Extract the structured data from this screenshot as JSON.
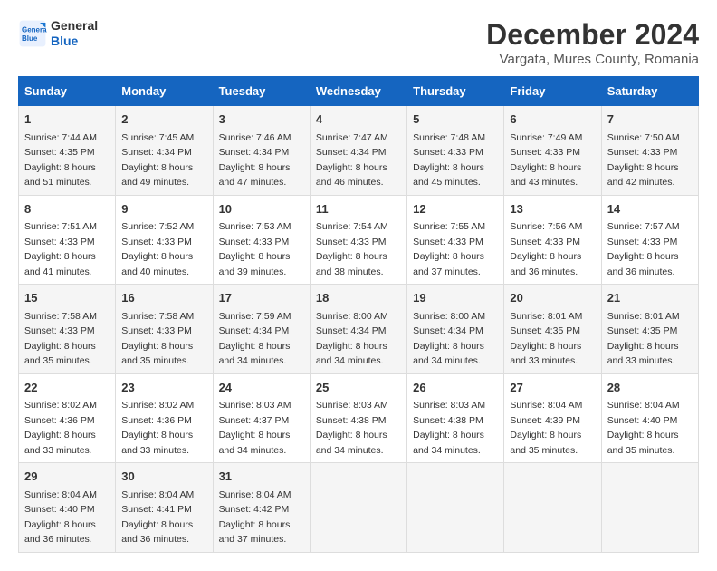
{
  "logo": {
    "line1": "General",
    "line2": "Blue"
  },
  "title": "December 2024",
  "subtitle": "Vargata, Mures County, Romania",
  "days_of_week": [
    "Sunday",
    "Monday",
    "Tuesday",
    "Wednesday",
    "Thursday",
    "Friday",
    "Saturday"
  ],
  "weeks": [
    [
      {
        "day": 1,
        "rise": "7:44 AM",
        "set": "4:35 PM",
        "daylight": "8 hours and 51 minutes."
      },
      {
        "day": 2,
        "rise": "7:45 AM",
        "set": "4:34 PM",
        "daylight": "8 hours and 49 minutes."
      },
      {
        "day": 3,
        "rise": "7:46 AM",
        "set": "4:34 PM",
        "daylight": "8 hours and 47 minutes."
      },
      {
        "day": 4,
        "rise": "7:47 AM",
        "set": "4:34 PM",
        "daylight": "8 hours and 46 minutes."
      },
      {
        "day": 5,
        "rise": "7:48 AM",
        "set": "4:33 PM",
        "daylight": "8 hours and 45 minutes."
      },
      {
        "day": 6,
        "rise": "7:49 AM",
        "set": "4:33 PM",
        "daylight": "8 hours and 43 minutes."
      },
      {
        "day": 7,
        "rise": "7:50 AM",
        "set": "4:33 PM",
        "daylight": "8 hours and 42 minutes."
      }
    ],
    [
      {
        "day": 8,
        "rise": "7:51 AM",
        "set": "4:33 PM",
        "daylight": "8 hours and 41 minutes."
      },
      {
        "day": 9,
        "rise": "7:52 AM",
        "set": "4:33 PM",
        "daylight": "8 hours and 40 minutes."
      },
      {
        "day": 10,
        "rise": "7:53 AM",
        "set": "4:33 PM",
        "daylight": "8 hours and 39 minutes."
      },
      {
        "day": 11,
        "rise": "7:54 AM",
        "set": "4:33 PM",
        "daylight": "8 hours and 38 minutes."
      },
      {
        "day": 12,
        "rise": "7:55 AM",
        "set": "4:33 PM",
        "daylight": "8 hours and 37 minutes."
      },
      {
        "day": 13,
        "rise": "7:56 AM",
        "set": "4:33 PM",
        "daylight": "8 hours and 36 minutes."
      },
      {
        "day": 14,
        "rise": "7:57 AM",
        "set": "4:33 PM",
        "daylight": "8 hours and 36 minutes."
      }
    ],
    [
      {
        "day": 15,
        "rise": "7:58 AM",
        "set": "4:33 PM",
        "daylight": "8 hours and 35 minutes."
      },
      {
        "day": 16,
        "rise": "7:58 AM",
        "set": "4:33 PM",
        "daylight": "8 hours and 35 minutes."
      },
      {
        "day": 17,
        "rise": "7:59 AM",
        "set": "4:34 PM",
        "daylight": "8 hours and 34 minutes."
      },
      {
        "day": 18,
        "rise": "8:00 AM",
        "set": "4:34 PM",
        "daylight": "8 hours and 34 minutes."
      },
      {
        "day": 19,
        "rise": "8:00 AM",
        "set": "4:34 PM",
        "daylight": "8 hours and 34 minutes."
      },
      {
        "day": 20,
        "rise": "8:01 AM",
        "set": "4:35 PM",
        "daylight": "8 hours and 33 minutes."
      },
      {
        "day": 21,
        "rise": "8:01 AM",
        "set": "4:35 PM",
        "daylight": "8 hours and 33 minutes."
      }
    ],
    [
      {
        "day": 22,
        "rise": "8:02 AM",
        "set": "4:36 PM",
        "daylight": "8 hours and 33 minutes."
      },
      {
        "day": 23,
        "rise": "8:02 AM",
        "set": "4:36 PM",
        "daylight": "8 hours and 33 minutes."
      },
      {
        "day": 24,
        "rise": "8:03 AM",
        "set": "4:37 PM",
        "daylight": "8 hours and 34 minutes."
      },
      {
        "day": 25,
        "rise": "8:03 AM",
        "set": "4:38 PM",
        "daylight": "8 hours and 34 minutes."
      },
      {
        "day": 26,
        "rise": "8:03 AM",
        "set": "4:38 PM",
        "daylight": "8 hours and 34 minutes."
      },
      {
        "day": 27,
        "rise": "8:04 AM",
        "set": "4:39 PM",
        "daylight": "8 hours and 35 minutes."
      },
      {
        "day": 28,
        "rise": "8:04 AM",
        "set": "4:40 PM",
        "daylight": "8 hours and 35 minutes."
      }
    ],
    [
      {
        "day": 29,
        "rise": "8:04 AM",
        "set": "4:40 PM",
        "daylight": "8 hours and 36 minutes."
      },
      {
        "day": 30,
        "rise": "8:04 AM",
        "set": "4:41 PM",
        "daylight": "8 hours and 36 minutes."
      },
      {
        "day": 31,
        "rise": "8:04 AM",
        "set": "4:42 PM",
        "daylight": "8 hours and 37 minutes."
      },
      null,
      null,
      null,
      null
    ]
  ]
}
